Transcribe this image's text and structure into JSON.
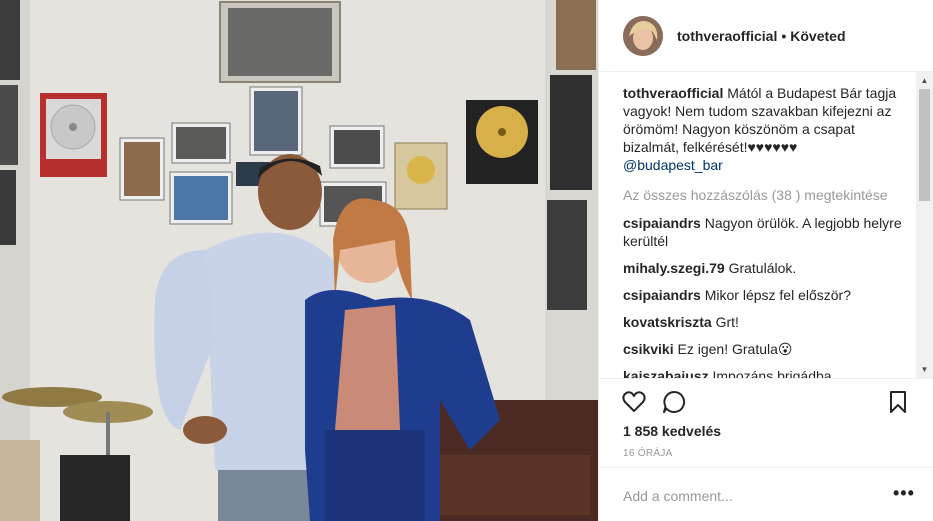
{
  "post": {
    "username": "tothveraofficial",
    "following_separator": "•",
    "following_label": "Követed",
    "caption_author": "tothveraofficial",
    "caption_text": "Mától a Budapest Bár tagja vagyok! Nem tudom szavakban kifejezni az örömöm! Nagyon köszönöm a csapat bizalmát, felkérését!♥♥♥♥♥♥",
    "caption_mention": "@budapest_bar",
    "view_all_comments": "Az összes hozzászólás (38 ) megtekintése",
    "comments": [
      {
        "user": "csipaiandrs",
        "text": "Nagyon örülök. A legjobb helyre kerültél"
      },
      {
        "user": "mihaly.szegi.79",
        "text": "Gratulálok."
      },
      {
        "user": "csipaiandrs",
        "text": "Mikor lépsz fel először?"
      },
      {
        "user": "kovatskriszta",
        "text": "Grt!"
      },
      {
        "user": "csikviki",
        "text": "Ez igen! Gratula😮"
      },
      {
        "user": "kajszabajusz",
        "text": "Impozáns brigádba csöppentél.ez igen!"
      }
    ],
    "likes": "1 858 kedvelés",
    "time_ago": "16 ÓRÁJA",
    "add_comment_placeholder": "Add a comment...",
    "more_label": "•••"
  },
  "icons": {
    "like": "heart-icon",
    "comment": "comment-bubble-icon",
    "save": "bookmark-icon",
    "more": "ellipsis-icon"
  },
  "colors": {
    "text": "#262626",
    "secondary": "#999999",
    "mention": "#003569",
    "divider": "#efefef"
  }
}
